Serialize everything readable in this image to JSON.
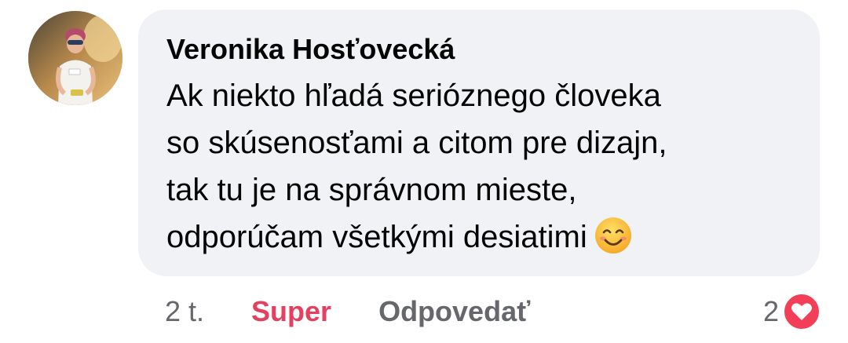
{
  "comment": {
    "author": "Veronika Hosťovecká",
    "lines": [
      "Ak niekto hľadá serióznego človeka",
      "so skúsenosťami a citom pre dizajn,",
      "tak tu je na správnom mieste,",
      "odporúčam všetkými desiatimi"
    ],
    "emoji": "smiling-face-icon",
    "avatar_icon": "profile-photo-icon"
  },
  "actions": {
    "time": "2 t.",
    "react_label": "Super",
    "reply_label": "Odpovedať"
  },
  "reactions": {
    "count": "2",
    "icon": "heart-icon"
  },
  "colors": {
    "bubble_bg": "#f0f2f5",
    "react_color": "#e4405f",
    "muted": "#65676b",
    "heart": "#f33e58"
  }
}
